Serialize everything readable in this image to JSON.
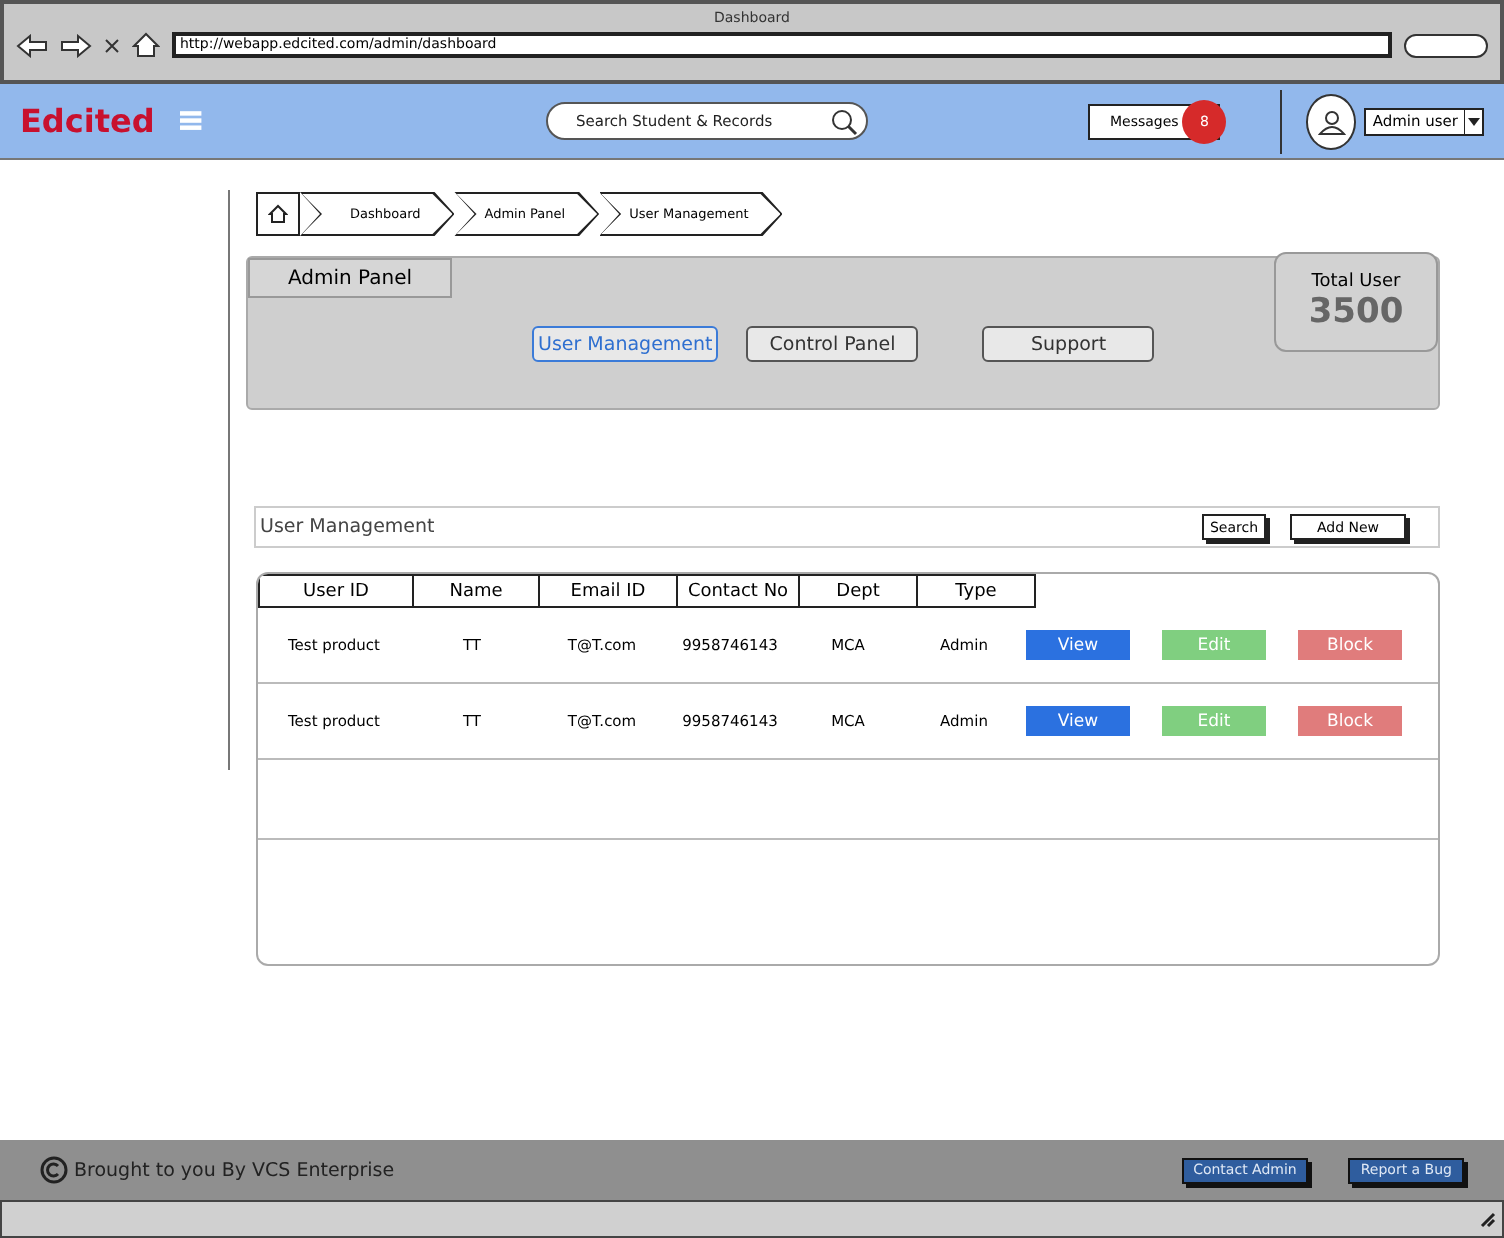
{
  "browser": {
    "title": "Dashboard",
    "url": "http://webapp.edcited.com/admin/dashboard"
  },
  "header": {
    "logo": "Edcited",
    "search_placeholder": "Search  Student  & Records",
    "messages": {
      "label": "Messages",
      "count": "8"
    },
    "user": "Admin user"
  },
  "breadcrumb": [
    "Dashboard",
    "Admin Panel",
    "User Management"
  ],
  "admin_panel": {
    "title": "Admin Panel",
    "tabs": [
      {
        "label": "User Management",
        "selected": true
      },
      {
        "label": "Control Panel",
        "selected": false
      },
      {
        "label": "Support",
        "selected": false
      }
    ],
    "total": {
      "label": "Total User",
      "value": "3500"
    }
  },
  "section": {
    "title": "User Management",
    "buttons": [
      "Search",
      "Add New"
    ]
  },
  "table": {
    "columns": [
      "User ID",
      "Name",
      "Email ID",
      "Contact No",
      "Dept",
      "Type"
    ],
    "rows": [
      {
        "cells": [
          "Test product",
          "TT",
          "T@T.com",
          "9958746143",
          "MCA",
          "Admin"
        ],
        "actions": [
          "View",
          "Edit",
          "Block"
        ]
      },
      {
        "cells": [
          "Test product",
          "TT",
          "T@T.com",
          "9958746143",
          "MCA",
          "Admin"
        ],
        "actions": [
          "View",
          "Edit",
          "Block"
        ]
      }
    ]
  },
  "footer": {
    "text": "Brought to you By VCS Enterprise",
    "buttons": [
      "Contact Admin",
      "Report a Bug"
    ]
  }
}
